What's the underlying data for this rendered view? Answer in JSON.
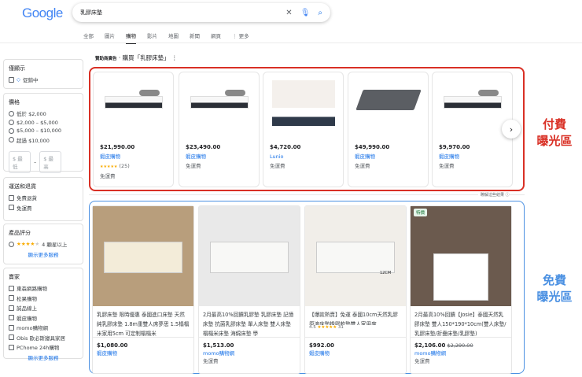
{
  "header": {
    "logo": "Google",
    "query": "乳膠床墊",
    "tabs": [
      "全部",
      "圖片",
      "購物",
      "影片",
      "地圖",
      "新聞",
      "網頁",
      "⋮ 更多"
    ],
    "active_tab": 2
  },
  "sidebar": {
    "show_only": {
      "title": "僅顯示",
      "items": [
        "促銷中"
      ]
    },
    "price": {
      "title": "價格",
      "options": [
        "低於 $2,000",
        "$2,000 – $5,000",
        "$5,000 – $10,000",
        "超過 $10,000"
      ],
      "min_placeholder": "$ 最低",
      "max_placeholder": "$ 最高",
      "sep": "–"
    },
    "shipping": {
      "title": "運送和退貨",
      "items": [
        "免費退貨",
        "免運費"
      ]
    },
    "rating": {
      "title": "產品評分",
      "label": "4 顆星以上",
      "stars": 4,
      "more": "顯示更多服務"
    },
    "sellers": {
      "title": "賣家",
      "items": [
        "東森網路購物",
        "松果購物",
        "誠品線上",
        "蝦皮購物",
        "momo購物網",
        "Obis 歐必斯寢具家居",
        "PChome 24h購物"
      ],
      "more": "顯示更多服務"
    }
  },
  "ads": {
    "sponsored": "贊助商廣告",
    "title": "· 購買「乳膠床墊」",
    "footer": "瞭解這些結果 ⓘ",
    "items": [
      {
        "price": "$21,990.00",
        "seller": "蝦皮購物",
        "rating": "★★★★★",
        "reviews": "(25)",
        "shipping": "免運費"
      },
      {
        "price": "$23,490.00",
        "seller": "蝦皮購物",
        "shipping": "免運費"
      },
      {
        "price": "$4,720.00",
        "seller": "Lunio",
        "shipping": "免運費"
      },
      {
        "price": "$49,990.00",
        "seller": "蝦皮購物",
        "shipping": "免運費"
      },
      {
        "price": "$9,970.00",
        "seller": "蝦皮購物",
        "shipping": "免運費"
      }
    ]
  },
  "labels": {
    "paid": [
      "付費",
      "曝光區"
    ],
    "free": [
      "免費",
      "曝光區"
    ],
    "paid_color": "#d93025",
    "free_color": "#4a90e2"
  },
  "free": {
    "items": [
      {
        "title": "乳膠床墊 限時優惠 泰國進口床墊 天然純乳膠床墊 1.8m重雙人席夢思 1.5榻榻米家用5cm 可定制榻榻米",
        "price": "$1,080.00",
        "seller": "蝦皮購物"
      },
      {
        "title": "2月最高10%回饋乳膠墊 乳膠床墊 記憶床墊 抗菌乳膠床墊 單人床墊 雙人床墊 榻榻米床墊 海綿床墊 學",
        "price": "$1,513.00",
        "seller": "momo購物網",
        "shipping": "免運費"
      },
      {
        "title": "【爆款熱賣】免運 泰國10cm天然乳膠原液床墊橡膠軟墊雙人家用席",
        "rating_value": "4.5",
        "rating": "★★★★★",
        "reviews": "31",
        "price": "$992.00",
        "seller": "蝦皮購物",
        "img_label": "12CM"
      },
      {
        "title": "2月最高10%回饋【Josie】泰國天然乳膠床墊 雙人150*190*10cm(雙人床墊/乳膠床墊/折疊床墊/乳膠墊)",
        "badge": "特價",
        "price": "$2,106.00",
        "old_price": "$2,290.00",
        "seller": "momo購物網",
        "shipping": "免運費"
      }
    ]
  }
}
